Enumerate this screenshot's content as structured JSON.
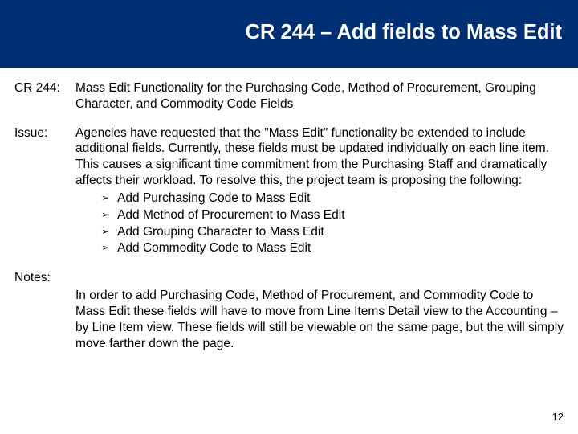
{
  "title": "CR 244 – Add fields to Mass Edit",
  "sections": {
    "cr_label": "CR 244:",
    "cr_body": "Mass Edit Functionality for the Purchasing Code, Method of Procurement, Grouping Character, and Commodity Code Fields",
    "issue_label": "Issue:",
    "issue_body": "Agencies have requested that the \"Mass Edit\" functionality be extended to include additional fields.  Currently, these fields must be updated individually on each line item.  This causes a significant time commitment from the Purchasing Staff and dramatically affects their workload.   To resolve this, the project team is proposing the following:",
    "issue_bullets": [
      "Add Purchasing Code to Mass Edit",
      "Add Method of Procurement to Mass Edit",
      "Add Grouping Character to Mass Edit",
      "Add Commodity Code to Mass Edit"
    ],
    "notes_label": "Notes:",
    "notes_body": "In order to add Purchasing Code, Method of Procurement, and Commodity Code to Mass Edit these fields will have to move from Line Items Detail view to the Accounting – by Line Item view.  These fields will still be viewable on the same page, but the will simply move farther down the page."
  },
  "page_number": "12"
}
